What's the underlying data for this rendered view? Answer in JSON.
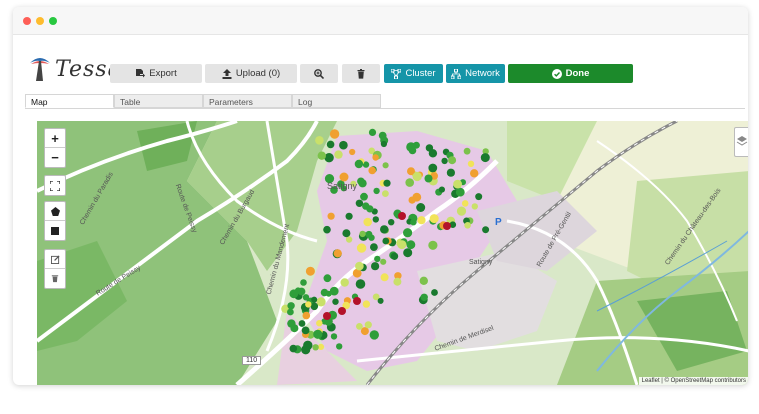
{
  "app": {
    "logo_text": "Tessa"
  },
  "toolbar": {
    "export_label": "Export",
    "upload_label": "Upload (0)",
    "cluster_label": "Cluster",
    "network_label": "Network",
    "done_label": "Done"
  },
  "tabs": [
    {
      "label": "Map",
      "active": true
    },
    {
      "label": "Table",
      "active": false
    },
    {
      "label": "Parameters",
      "active": false
    },
    {
      "label": "Log",
      "active": false
    }
  ],
  "map": {
    "labels": {
      "chemin_paradis": "Chemin du Paradis",
      "route_peissy_top": "Route de Peissy",
      "route_peissy_left": "Route de Peissy",
      "chemin_burgaud": "Chemin du Burgaud",
      "chemin_mandement": "Chemin du Mandement",
      "satigny_town": "Satigny",
      "satigny_station": "Satigny",
      "route_pre_gentil": "Route de Pré-Gentil",
      "chemin_merdisel": "Chemin de Merdisel",
      "chemin_chateau_bois": "Chemin du Château-des-Bois",
      "route_110": "110",
      "parking": "P"
    },
    "attribution": "Leaflet | © OpenStreetMap contributors",
    "colors": {
      "dark_green": "#1a7a2e",
      "green": "#2f9e3a",
      "light_green": "#7cc24b",
      "yellow_green": "#c9e06a",
      "yellow": "#f1e35a",
      "orange": "#f0a030",
      "dark_red": "#b3122a",
      "residential": "#e6c9e6",
      "farmland": "#d6e8c4",
      "vineyard": "#8fc27a"
    }
  }
}
